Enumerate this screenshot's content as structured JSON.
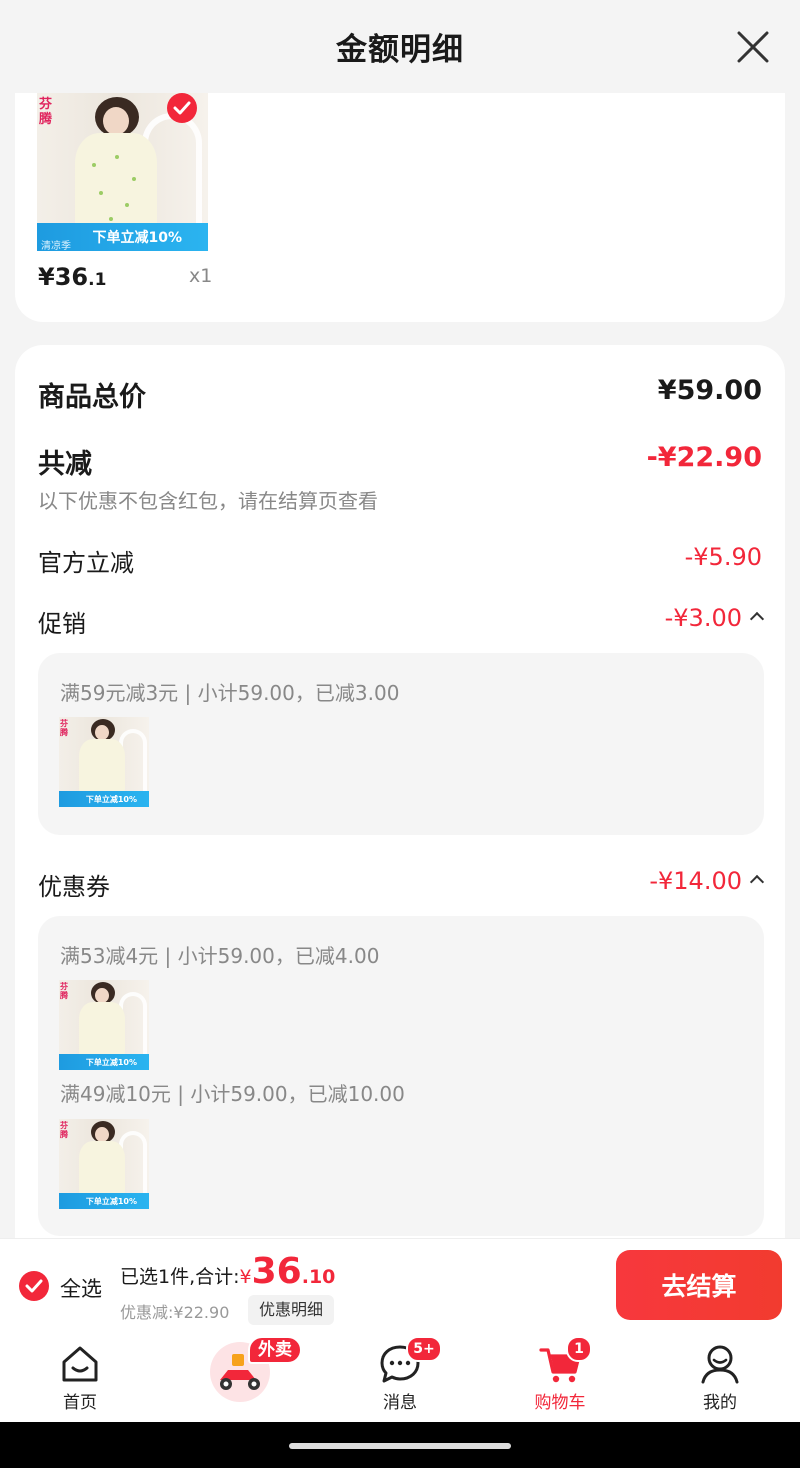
{
  "header": {
    "title": "金额明细"
  },
  "product": {
    "brand": "芬腾",
    "banner_small": "清凉季",
    "banner_text": "下单立减10%",
    "price_symbol": "¥",
    "price_int": "36",
    "price_dec": ".1",
    "quantity": "x1"
  },
  "summary": {
    "total_label": "商品总价",
    "total_value": "¥59.00",
    "reduction_label": "共减",
    "reduction_value": "-¥22.90",
    "reduction_note": "以下优惠不包含红包，请在结算页查看",
    "official_label": "官方立减",
    "official_value": "-¥5.90",
    "promo_label": "促销",
    "promo_value": "-¥3.00",
    "promo_rule": "满59元减3元 | 小计59.00，已减3.00",
    "coupon_label": "优惠券",
    "coupon_value": "-¥14.00",
    "coupon_rules": [
      "满53减4元 | 小计59.00，已减4.00",
      "满49减10元 | 小计59.00，已减10.00"
    ]
  },
  "checkout": {
    "select_all": "全选",
    "selected_prefix": "已选1件,合计:",
    "yen": "¥",
    "total_int": "36",
    "total_dec": ".10",
    "discount": "优惠减:¥22.90",
    "detail_chip": "优惠明细",
    "button": "去结算"
  },
  "tabbar": {
    "items": [
      {
        "label": "首页"
      },
      {
        "label": "外卖"
      },
      {
        "label": "消息",
        "badge": "5+"
      },
      {
        "label": "购物车",
        "badge": "1"
      },
      {
        "label": "我的"
      }
    ]
  },
  "colors": {
    "accent": "#f2273a",
    "banner": "#1e9be0"
  }
}
